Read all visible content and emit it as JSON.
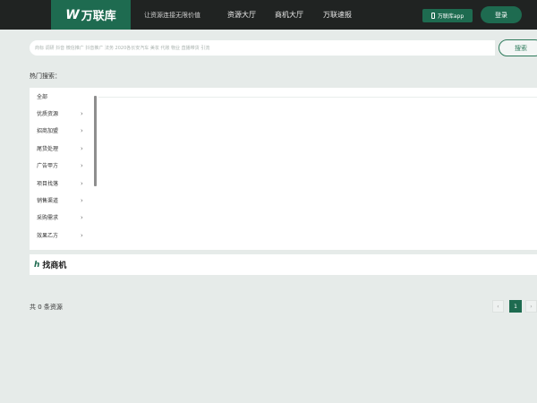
{
  "header": {
    "logo_mark": "W",
    "logo_text": "万联库",
    "slogan": "让资源连接无限价值",
    "nav": [
      "资源大厅",
      "商机大厅",
      "万联速报"
    ],
    "app_button_label": "万联库app",
    "login_label": "登录"
  },
  "search": {
    "placeholder": "商标 调研 抖音 微信推广 抖音推广 法务 2020各长安汽车 美妆 代账 物业 直播带货 引流",
    "button_label": "搜索"
  },
  "hot_search_label": "热门搜索：",
  "categories": {
    "items": [
      "全部",
      "优质资源",
      "招商加盟",
      "尾货处理",
      "广告甲方",
      "项目找落",
      "销售渠道",
      "采购需求",
      "效果乙方"
    ],
    "arrow": "›"
  },
  "business": {
    "icon": "h",
    "title": "找商机"
  },
  "footer": {
    "total_text": "共 0 条资源",
    "pager_prev": "‹",
    "pager_current": "1",
    "pager_next": "›"
  },
  "colors": {
    "brand_green": "#1e6b50",
    "header_bg": "#202322",
    "page_bg": "#e6ebe9"
  }
}
